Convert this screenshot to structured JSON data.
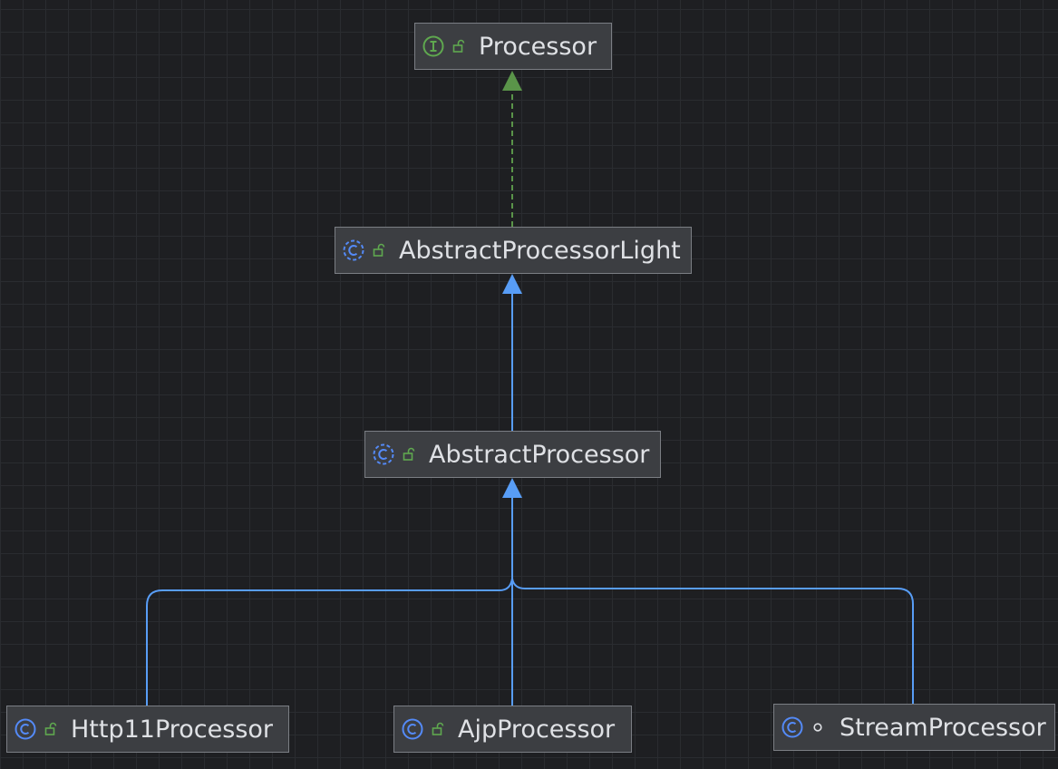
{
  "colors": {
    "background": "#1e1f22",
    "node_fill": "#3c3e42",
    "node_border": "#7b7e84",
    "text": "#dfe1e5",
    "interface_icon": "#5fa84f",
    "class_icon": "#548af7",
    "public_icon": "#5fa84f",
    "realization_edge": "#5a9449",
    "inheritance_edge": "#589df6"
  },
  "nodes": [
    {
      "id": "processor",
      "name": "Processor",
      "kind": "interface",
      "kind_icon": "interface-icon",
      "visibility": "public",
      "visibility_icon": "public-lock-icon"
    },
    {
      "id": "abstract-processor-light",
      "name": "AbstractProcessorLight",
      "kind": "abstract-class",
      "kind_icon": "abstract-class-icon",
      "visibility": "public",
      "visibility_icon": "public-lock-icon"
    },
    {
      "id": "abstract-processor",
      "name": "AbstractProcessor",
      "kind": "abstract-class",
      "kind_icon": "abstract-class-icon",
      "visibility": "public",
      "visibility_icon": "public-lock-icon"
    },
    {
      "id": "http11-processor",
      "name": "Http11Processor",
      "kind": "class",
      "kind_icon": "class-icon",
      "visibility": "public",
      "visibility_icon": "public-lock-icon"
    },
    {
      "id": "ajp-processor",
      "name": "AjpProcessor",
      "kind": "class",
      "kind_icon": "class-icon",
      "visibility": "public",
      "visibility_icon": "public-lock-icon"
    },
    {
      "id": "stream-processor",
      "name": "StreamProcessor",
      "kind": "class",
      "kind_icon": "class-icon",
      "visibility": "package-private",
      "visibility_icon": "package-private-icon"
    }
  ],
  "edges": [
    {
      "from": "abstract-processor-light",
      "to": "processor",
      "type": "realization"
    },
    {
      "from": "abstract-processor",
      "to": "abstract-processor-light",
      "type": "inheritance"
    },
    {
      "from": "http11-processor",
      "to": "abstract-processor",
      "type": "inheritance"
    },
    {
      "from": "ajp-processor",
      "to": "abstract-processor",
      "type": "inheritance"
    },
    {
      "from": "stream-processor",
      "to": "abstract-processor",
      "type": "inheritance"
    }
  ]
}
